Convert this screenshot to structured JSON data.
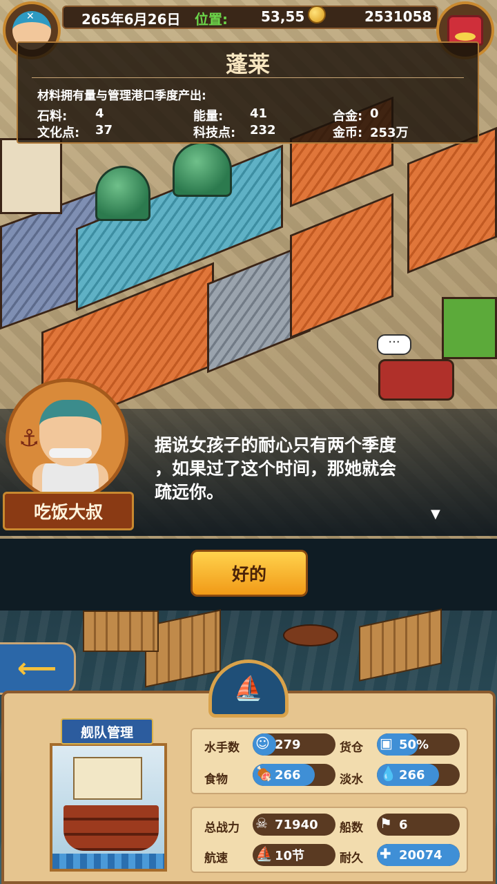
{
  "hud": {
    "date": "265年6月26日",
    "position_label": "位置:",
    "position_value": "53,55",
    "gold": "2531058"
  },
  "port": {
    "name": "蓬莱",
    "subtitle": "材料拥有量与管理港口季度产出:",
    "stats": [
      {
        "label": "石料:",
        "value": "4"
      },
      {
        "label": "能量:",
        "value": "41"
      },
      {
        "label": "合金:",
        "value": "0"
      },
      {
        "label": "文化点:",
        "value": "37"
      },
      {
        "label": "科技点:",
        "value": "232"
      },
      {
        "label": "金币:",
        "value": "253万"
      }
    ]
  },
  "dialog": {
    "speaker": "吃饭大叔",
    "text_lines": [
      "据说女孩子的耐心只有两个季度",
      "，如果过了这个时间，那她就会",
      "疏远你。"
    ],
    "confirm_label": "好的"
  },
  "fleet": {
    "tab_label": "舰队管理",
    "stats": {
      "sailors": {
        "label": "水手数",
        "value": "279",
        "icon": "sailor-icon"
      },
      "cargo": {
        "label": "货仓",
        "value": "50%",
        "fill": 0.5,
        "icon": "crate-icon"
      },
      "food": {
        "label": "食物",
        "value": "266",
        "icon": "meat-icon"
      },
      "water": {
        "label": "淡水",
        "value": "266",
        "icon": "water-icon"
      },
      "power": {
        "label": "总战力",
        "value": "71940",
        "icon": "skull-icon"
      },
      "ships": {
        "label": "船数",
        "value": "6",
        "icon": "boot-icon"
      },
      "speed": {
        "label": "航速",
        "value": "10节",
        "icon": "ship-icon"
      },
      "durability": {
        "label": "耐久",
        "value": "20074",
        "icon": "repair-icon"
      }
    }
  },
  "colors": {
    "accent_orange": "#f19a17",
    "panel_brown": "#3a2718",
    "stat_blue": "#3f8fd6"
  }
}
